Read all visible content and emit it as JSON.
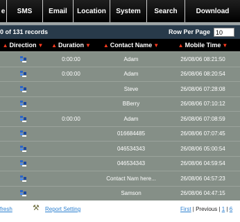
{
  "nav": {
    "items": [
      "e",
      "SMS",
      "Email",
      "Location",
      "System",
      "Search",
      "Download"
    ]
  },
  "records": {
    "summary": "0 of 131 records",
    "rows_per_page_label": "Row Per Page",
    "rows_per_page_value": "10"
  },
  "columns": {
    "direction": "Direction",
    "duration": "Duration",
    "contact_name": "Contact Name",
    "mobile_time": "Mobile Time"
  },
  "rows": [
    {
      "duration": "0:00:00",
      "contact": "Adam",
      "time": "26/08/06 08:21:50"
    },
    {
      "duration": "0:00:00",
      "contact": "Adam",
      "time": "26/08/06 08:20:54"
    },
    {
      "duration": "",
      "contact": "Steve",
      "time": "26/08/06 07:28:08"
    },
    {
      "duration": "",
      "contact": "BBerry",
      "time": "26/08/06 07:10:12"
    },
    {
      "duration": "0:00:00",
      "contact": "Adam",
      "time": "26/08/06 07:08:59"
    },
    {
      "duration": "",
      "contact": "016684485",
      "time": "26/08/06 07:07:45"
    },
    {
      "duration": "",
      "contact": "046534343",
      "time": "26/08/06 05:00:54"
    },
    {
      "duration": "",
      "contact": "046534343",
      "time": "26/08/06 04:59:54"
    },
    {
      "duration": "",
      "contact": "Contact Nam here...",
      "time": "26/08/06 04:57:23"
    },
    {
      "duration": "",
      "contact": "Samson",
      "time": "26/08/06 04:47:15"
    }
  ],
  "footer": {
    "refresh": "fresh",
    "report_setting": "Report Setting",
    "first": "First",
    "pager_sep1": " | ",
    "previous": "Previous",
    "pager_sep2": " | ",
    "page_1": "1",
    "pager_sep3": " | ",
    "page_2": "6"
  },
  "icons": {
    "direction": "call-direction-icon",
    "report_setting": "tools-icon",
    "sort_arrow": "triangle-arrow"
  },
  "colors": {
    "nav_bg": "#000000",
    "records_bar": "#283a4a",
    "table_bg": "#858f87",
    "sort_arrow": "#ff3b1f",
    "link": "#2a7fd0"
  }
}
